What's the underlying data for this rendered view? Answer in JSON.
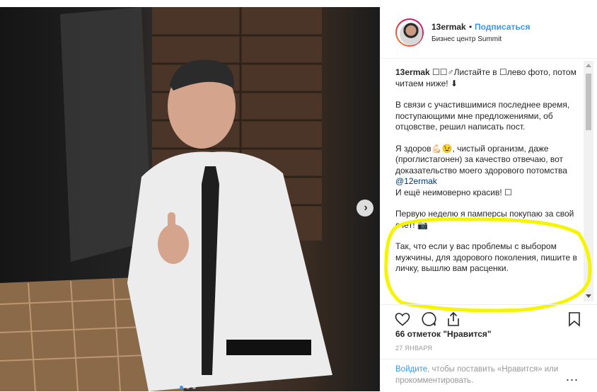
{
  "post": {
    "username": "13ermak",
    "separator": "•",
    "follow_label": "Подписаться",
    "location": "Бизнес центр Summit"
  },
  "caption": {
    "author": "13ermak",
    "line1": " ☐☐♂Листайте в ☐лево фото, потом читаем ниже! ⬇",
    "para2": "В связи с участившимися последнее время, поступающими мне предложениями, об отцовстве, решил написать пост.",
    "para3a": "Я здоров💪🏻😉, чистый организм, даже (проглистагонен) за качество отвечаю, вот доказательство моего здорового потомства ",
    "mention": "@12ermak",
    "para3b": "И ещё неимоверно красив! ☐",
    "para4": "Первую неделю я памперсы покупаю за свой счёт! 📷",
    "para5": "Так, что если у вас проблемы с выбором мужчины, для здорового поколения, пишите в личку, вышлю вам расценки."
  },
  "likes": "66 отметок \"Нравится\"",
  "date": "27 ЯНВАРЯ",
  "login": {
    "link": "Войдите",
    "rest": ", чтобы поставить «Нравится» или прокомментировать.",
    "more": "..."
  },
  "carousel": {
    "next_glyph": "›",
    "total_slides": 3,
    "current_slide": 1
  },
  "icons": [
    "heart-icon",
    "comment-icon",
    "share-icon",
    "bookmark-icon"
  ],
  "colors": {
    "accent": "#3897f0",
    "highlight": "#f5f500"
  }
}
